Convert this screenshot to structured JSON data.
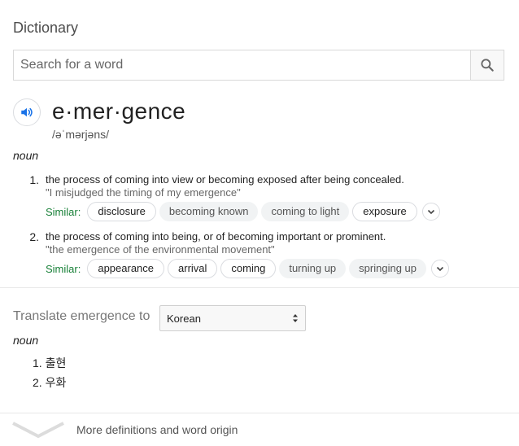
{
  "card": {
    "title": "Dictionary"
  },
  "search": {
    "placeholder": "Search for a word",
    "value": ""
  },
  "entry": {
    "word": "e·mer·gence",
    "phonetic": "/əˈmərjəns/",
    "part_of_speech": "noun",
    "similar_label": "Similar:",
    "definitions": [
      {
        "number": "1.",
        "text": "the process of coming into view or becoming exposed after being concealed.",
        "example": "\"I misjudged the timing of my emergence\"",
        "similar": [
          "disclosure",
          "becoming known",
          "coming to light",
          "exposure"
        ]
      },
      {
        "number": "2.",
        "text": "the process of coming into being, or of becoming important or prominent.",
        "example": "\"the emergence of the environmental movement\"",
        "similar": [
          "appearance",
          "arrival",
          "coming",
          "turning up",
          "springing up"
        ]
      }
    ]
  },
  "translate": {
    "label": "Translate emergence to",
    "language": "Korean",
    "part_of_speech": "noun",
    "results": [
      {
        "number": "1.",
        "text": "출현"
      },
      {
        "number": "2.",
        "text": "우화"
      }
    ]
  },
  "footer": {
    "more_label": "More definitions and word origin"
  },
  "icons": {
    "search": "search-icon",
    "speaker": "speaker-icon",
    "expand": "chevron-down-icon",
    "more": "chevron-down-icon"
  },
  "colors": {
    "accent": "#1a73e8",
    "similar_label": "#188038"
  }
}
